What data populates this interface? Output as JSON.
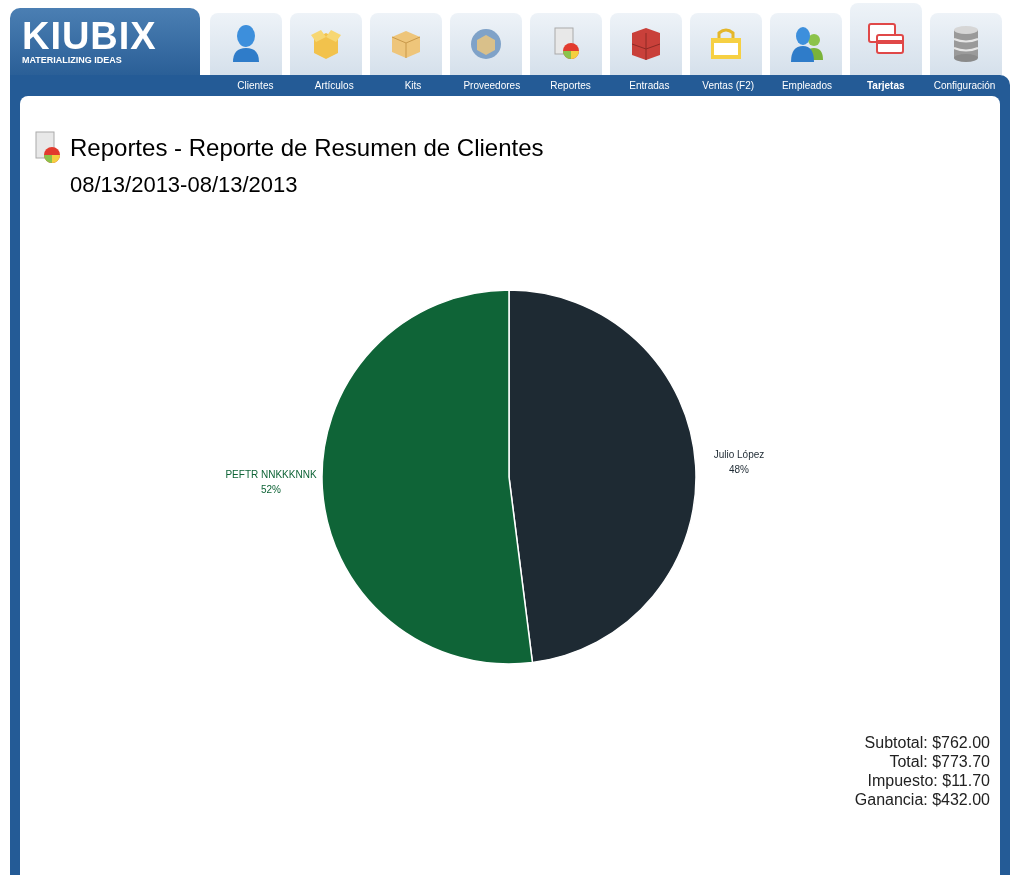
{
  "logo": {
    "name": "KIUBIX",
    "tagline": "MATERIALIZING IDEAS"
  },
  "tabs": [
    {
      "label": "Clientes",
      "selected": false
    },
    {
      "label": "Artículos",
      "selected": false
    },
    {
      "label": "Kits",
      "selected": false
    },
    {
      "label": "Proveedores",
      "selected": false
    },
    {
      "label": "Reportes",
      "selected": false
    },
    {
      "label": "Entradas",
      "selected": false
    },
    {
      "label": "Ventas (F2)",
      "selected": false
    },
    {
      "label": "Empleados",
      "selected": false
    },
    {
      "label": "Tarjetas",
      "selected": true
    },
    {
      "label": "Configuración",
      "selected": false
    }
  ],
  "report": {
    "title": "Reportes - Reporte de Resumen de Clientes",
    "date_range": "08/13/2013-08/13/2013",
    "slices": [
      {
        "color": "#1e2a33"
      },
      {
        "color": "#0f6437"
      }
    ],
    "chart_data": {
      "type": "pie",
      "categories": [
        "Julio López",
        "PEFTR NNKKKNNK"
      ],
      "values": [
        48,
        52
      ],
      "value_labels": [
        "48%",
        "52%"
      ]
    },
    "totals": [
      "Subtotal: $762.00",
      "Total: $773.70",
      "Impuesto: $11.70",
      "Ganancia: $432.00"
    ]
  }
}
